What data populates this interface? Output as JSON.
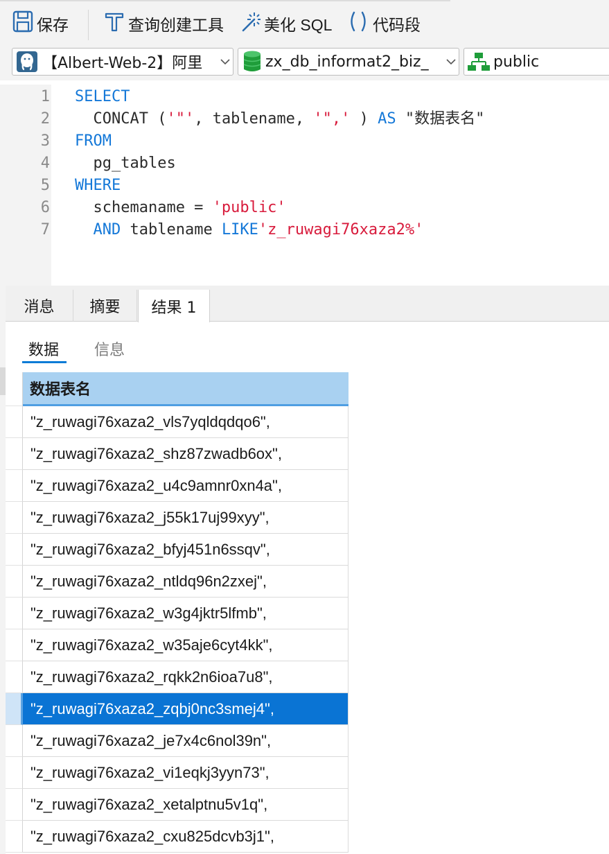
{
  "toolbar": {
    "save_label": "保存",
    "query_builder_label": "查询创建工具",
    "beautify_label": "美化 SQL",
    "snippet_label": "代码段"
  },
  "selectors": {
    "connection": "【Albert-Web-2】阿里",
    "database": "zx_db_informat2_biz_",
    "schema": "public"
  },
  "editor": {
    "line_numbers": [
      "1",
      "2",
      "3",
      "4",
      "5",
      "6",
      "7"
    ]
  },
  "result_tabs": [
    "消息",
    "摘要",
    "结果 1"
  ],
  "sub_tabs": [
    "数据",
    "信息"
  ],
  "grid": {
    "column": "数据表名",
    "rows": [
      "\"z_ruwagi76xaza2_vls7yqldqdqo6\",",
      "\"z_ruwagi76xaza2_shz87zwadb6ox\",",
      "\"z_ruwagi76xaza2_u4c9amnr0xn4a\",",
      "\"z_ruwagi76xaza2_j55k17uj99xyy\",",
      "\"z_ruwagi76xaza2_bfyj451n6ssqv\",",
      "\"z_ruwagi76xaza2_ntldq96n2zxej\",",
      "\"z_ruwagi76xaza2_w3g4jktr5lfmb\",",
      "\"z_ruwagi76xaza2_w35aje6cyt4kk\",",
      "\"z_ruwagi76xaza2_rqkk2n6ioa7u8\",",
      "\"z_ruwagi76xaza2_zqbj0nc3smej4\",",
      "\"z_ruwagi76xaza2_je7x4c6nol39n\",",
      "\"z_ruwagi76xaza2_vi1eqkj3yyn73\",",
      "\"z_ruwagi76xaza2_xetalptnu5v1q\",",
      "\"z_ruwagi76xaza2_cxu825dcvb3j1\","
    ],
    "selected_row": 9
  },
  "colors": {
    "keyword": "#1478d8",
    "string": "#d81b3c",
    "selection": "#0a74d4",
    "header": "#a9d1f1"
  },
  "icons": [
    "save-icon",
    "query-builder-icon",
    "beautify-icon",
    "code-snippet-icon",
    "postgres-icon",
    "database-icon",
    "schema-icon",
    "chevron-down-icon"
  ]
}
